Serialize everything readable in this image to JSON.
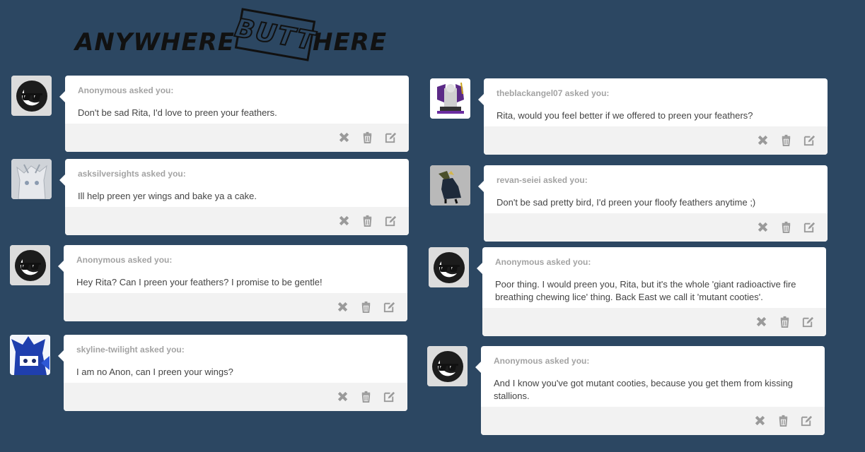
{
  "header": {
    "logo_left": "ANYWHERE",
    "logo_middle": "BUTT",
    "logo_right": "HERE"
  },
  "actions": {
    "delete_icon": "x-icon",
    "trash_icon": "trash-icon",
    "edit_icon": "edit-icon"
  },
  "asks": [
    {
      "asker": "Anonymous",
      "suffix": "asked you:",
      "message": "Don't be sad Rita, I'd love to preen your feathers.",
      "avatar": "anonymous-sunglasses-avatar"
    },
    {
      "asker": "asksilversights",
      "suffix": "asked you:",
      "message": "Ill help preen yer wings and bake ya a cake.",
      "avatar": "pony-avatar"
    },
    {
      "asker": "Anonymous",
      "suffix": "asked you:",
      "message": "Hey Rita? Can I preen your feathers? I promise to be gentle!",
      "avatar": "anonymous-sunglasses-avatar"
    },
    {
      "asker": "skyline-twilight",
      "suffix": "asked you:",
      "message": "I am no Anon, can I preen your wings?",
      "avatar": "blue-pony-avatar"
    },
    {
      "asker": "theblackangel07",
      "suffix": "asked you:",
      "message": "Rita, would you feel better if we offered to preen your feathers?",
      "avatar": "griffon-throne-avatar"
    },
    {
      "asker": "revan-seiei",
      "suffix": "asked you:",
      "message": "Don't be sad pretty bird, I'd preen your floofy feathers anytime ;)",
      "avatar": "griffon-avatar"
    },
    {
      "asker": "Anonymous",
      "suffix": "asked you:",
      "message": "Poor thing. I would preen you, Rita, but it's the whole 'giant radioactive fire breathing chewing lice' thing. Back East we call it 'mutant cooties'.",
      "avatar": "anonymous-sunglasses-avatar"
    },
    {
      "asker": "Anonymous",
      "suffix": "asked you:",
      "message": "And I know you've got mutant cooties, because you get them from kissing stallions.",
      "avatar": "anonymous-sunglasses-avatar"
    }
  ]
}
